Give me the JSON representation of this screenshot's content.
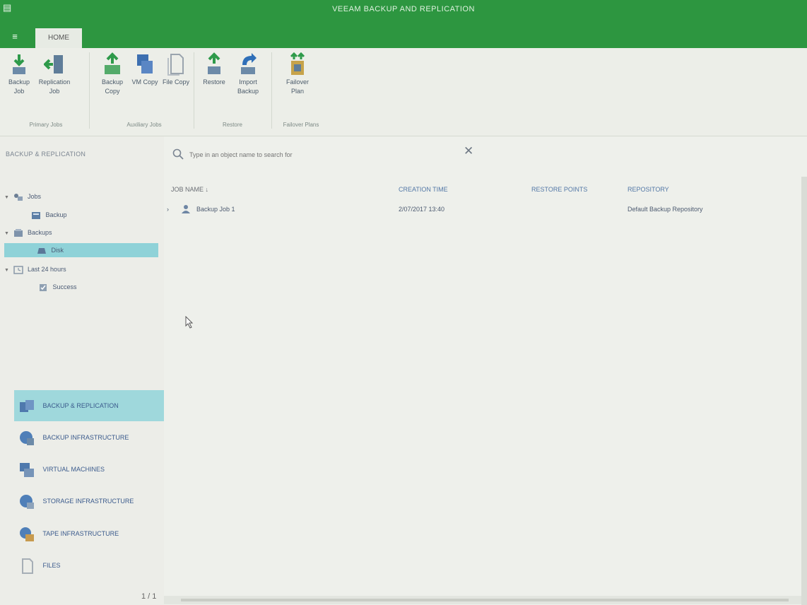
{
  "app": {
    "title": "VEEAM BACKUP AND REPLICATION",
    "menu_glyph": "≡",
    "active_tab": "HOME"
  },
  "ribbon": {
    "buttons": [
      {
        "label": "Backup Job",
        "icon": "backup-job-icon"
      },
      {
        "label": "Replication Job",
        "icon": "replication-job-icon"
      },
      {
        "label": "Backup Copy",
        "icon": "backup-copy-icon"
      },
      {
        "label": "VM Copy",
        "icon": "vm-copy-icon"
      },
      {
        "label": "File Copy",
        "icon": "file-copy-icon"
      },
      {
        "label": "Restore",
        "icon": "restore-icon"
      },
      {
        "label": "Import Backup",
        "icon": "import-backup-icon"
      },
      {
        "label": "Failover Plan",
        "icon": "failover-plan-icon"
      }
    ],
    "groups": [
      "Primary Jobs",
      "Auxiliary Jobs",
      "Restore",
      "Failover Plans"
    ]
  },
  "left_pane": {
    "title": "BACKUP & REPLICATION",
    "tree": [
      {
        "label": "Jobs"
      },
      {
        "label": "Backup"
      },
      {
        "label": "Backups"
      },
      {
        "label": "Disk"
      },
      {
        "label": "Last 24 hours"
      },
      {
        "label": "Success"
      }
    ],
    "nav": [
      {
        "label": "BACKUP & REPLICATION"
      },
      {
        "label": "BACKUP INFRASTRUCTURE"
      },
      {
        "label": "VIRTUAL MACHINES"
      },
      {
        "label": "STORAGE INFRASTRUCTURE"
      },
      {
        "label": "TAPE INFRASTRUCTURE"
      },
      {
        "label": "FILES"
      }
    ]
  },
  "search": {
    "placeholder": "Type in an object name to search for",
    "clear_glyph": "✕"
  },
  "table": {
    "columns": [
      "JOB NAME ↓",
      "CREATION TIME",
      "RESTORE POINTS",
      "REPOSITORY"
    ],
    "rows": [
      {
        "expand": "›",
        "name": "Backup Job 1",
        "created": "2/07/2017 13:40",
        "restore_points": "",
        "repository": "Default Backup Repository"
      }
    ]
  },
  "status": {
    "pager": "1 / 1"
  },
  "colors": {
    "title_bar": "#2d9640",
    "selection": "#8fd2d8",
    "link": "#5277a6"
  }
}
